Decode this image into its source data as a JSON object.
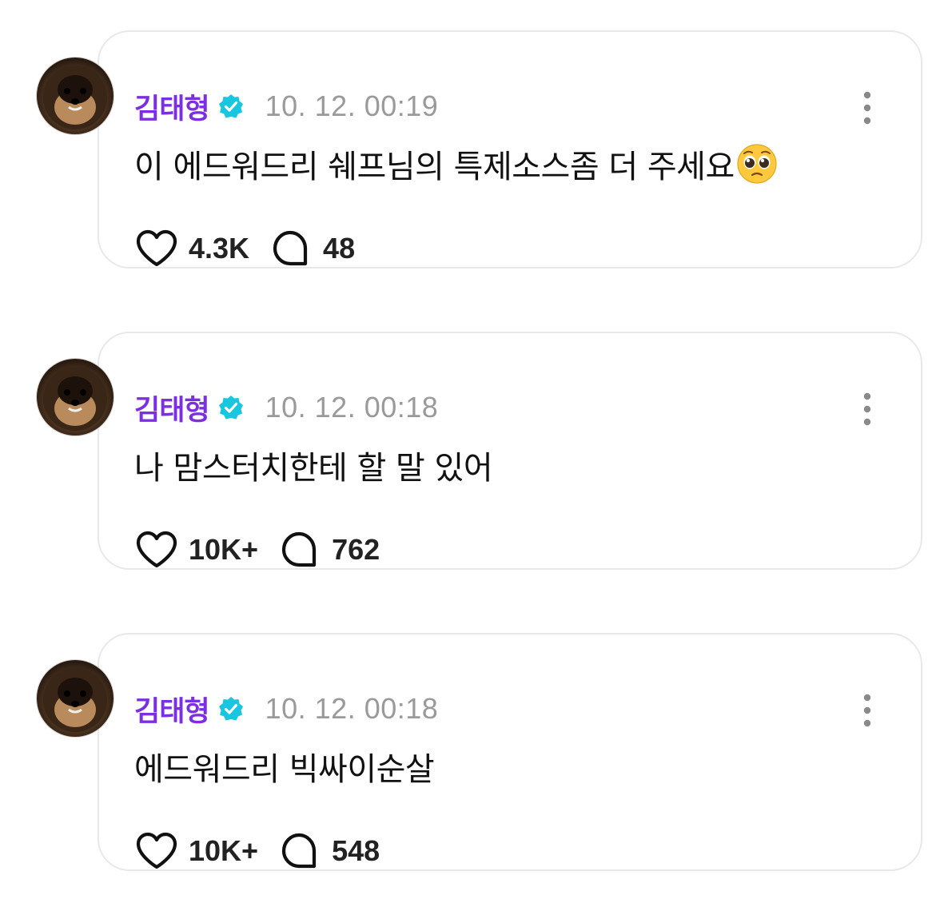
{
  "colors": {
    "username": "#7b2fe0",
    "verified_badge": "#19c6e0",
    "timestamp": "#9a9a9a",
    "card_border": "#e8e8e8"
  },
  "posts": [
    {
      "username": "김태형",
      "verified_icon": "verified-badge-icon",
      "timestamp": "10. 12. 00:19",
      "text": "이 에드워드리 쉐프님의 특제소스좀 더 주세요",
      "emoji": "pleading-face-emoji",
      "likes": "4.3K",
      "comments": "48"
    },
    {
      "username": "김태형",
      "verified_icon": "verified-badge-icon",
      "timestamp": "10. 12. 00:18",
      "text": "나 맘스터치한테 할 말 있어",
      "likes": "10K+",
      "comments": "762"
    },
    {
      "username": "김태형",
      "verified_icon": "verified-badge-icon",
      "timestamp": "10. 12. 00:18",
      "text": "에드워드리 빅싸이순살",
      "likes": "10K+",
      "comments": "548"
    }
  ]
}
